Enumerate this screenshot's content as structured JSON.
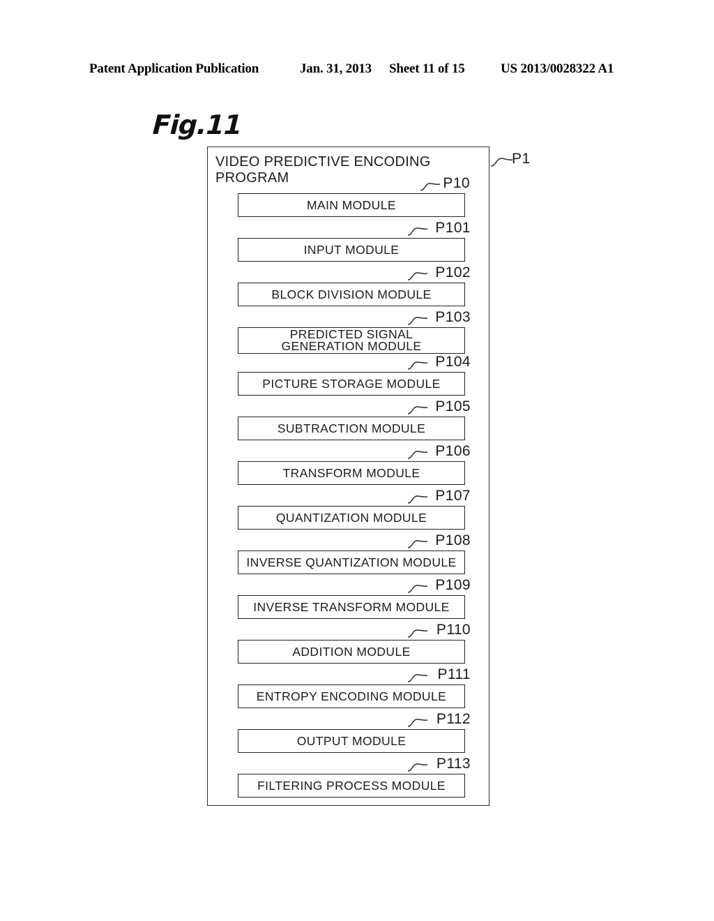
{
  "header": {
    "publication": "Patent Application Publication",
    "date": "Jan. 31, 2013",
    "sheet": "Sheet 11 of 15",
    "patent_number": "US 2013/0028322 A1"
  },
  "figure": {
    "caption": "Fig.11",
    "container": {
      "title": "VIDEO PREDICTIVE ENCODING\nPROGRAM",
      "reference": "P1"
    },
    "modules": [
      {
        "reference": "P10",
        "label": "MAIN MODULE"
      },
      {
        "reference": "P101",
        "label": "INPUT MODULE"
      },
      {
        "reference": "P102",
        "label": "BLOCK DIVISION MODULE"
      },
      {
        "reference": "P103",
        "label": "PREDICTED SIGNAL\nGENERATION MODULE"
      },
      {
        "reference": "P104",
        "label": "PICTURE STORAGE MODULE"
      },
      {
        "reference": "P105",
        "label": "SUBTRACTION MODULE"
      },
      {
        "reference": "P106",
        "label": "TRANSFORM MODULE"
      },
      {
        "reference": "P107",
        "label": "QUANTIZATION MODULE"
      },
      {
        "reference": "P108",
        "label": "INVERSE QUANTIZATION MODULE"
      },
      {
        "reference": "P109",
        "label": "INVERSE TRANSFORM MODULE"
      },
      {
        "reference": "P110",
        "label": "ADDITION MODULE"
      },
      {
        "reference": "P111",
        "label": "ENTROPY ENCODING MODULE"
      },
      {
        "reference": "P112",
        "label": "OUTPUT MODULE"
      },
      {
        "reference": "P113",
        "label": "FILTERING PROCESS MODULE"
      }
    ]
  }
}
